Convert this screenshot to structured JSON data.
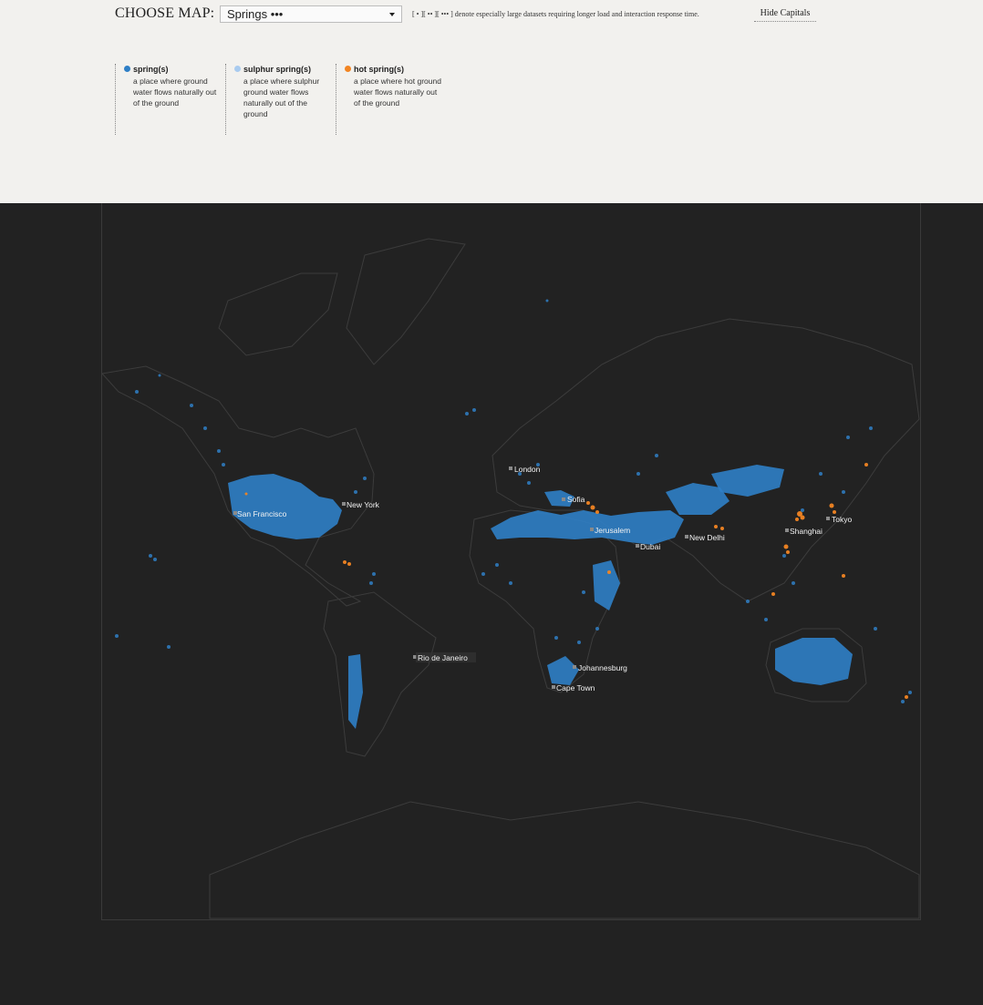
{
  "header": {
    "choose_label": "CHOOSE MAP:",
    "selected_map": "Springs •••",
    "hint": "[ • ][ •• ][ ••• ] denote especially large datasets requiring longer load and interaction response time.",
    "hide_capitals_label": "Hide Capitals"
  },
  "legend": [
    {
      "name": "spring(s)",
      "desc": "a place where ground water flows naturally out of the ground",
      "color": "#2f7fc6"
    },
    {
      "name": "sulphur spring(s)",
      "desc": "a place where sulphur ground water flows naturally out of the ground",
      "color": "#a9cbef"
    },
    {
      "name": "hot spring(s)",
      "desc": "a place where hot ground water flows naturally out of the ground",
      "color": "#f28522"
    }
  ],
  "colors": {
    "background": "#f2f1ee",
    "map_background": "#222222",
    "spring": "#2f7fc6",
    "hot_spring": "#f28522",
    "capital_marker": "#8a8a8a"
  },
  "cities": [
    {
      "name": "London"
    },
    {
      "name": "Sofia"
    },
    {
      "name": "Jerusalem"
    },
    {
      "name": "Dubai"
    },
    {
      "name": "New Delhi"
    },
    {
      "name": "Shanghai"
    },
    {
      "name": "Tokyo"
    },
    {
      "name": "San Francisco"
    },
    {
      "name": "New York"
    },
    {
      "name": "Rio de Janeiro"
    },
    {
      "name": "Johannesburg"
    },
    {
      "name": "Cape Town"
    }
  ]
}
